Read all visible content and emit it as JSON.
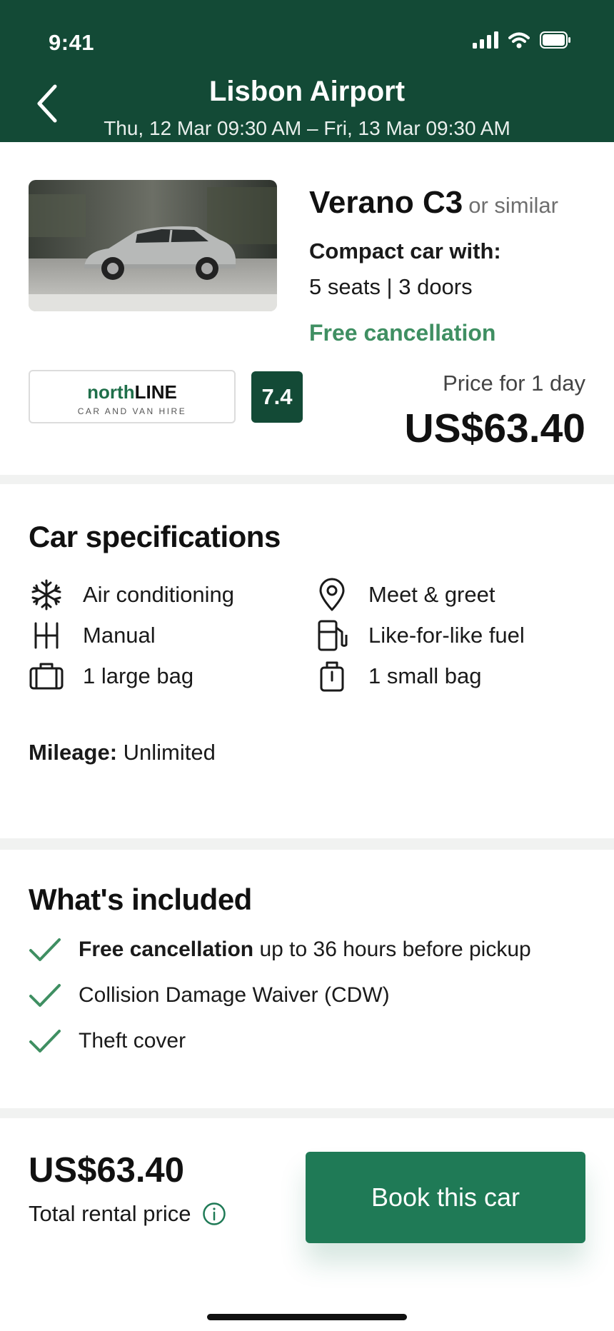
{
  "status_bar": {
    "time": "9:41"
  },
  "header": {
    "title": "Lisbon Airport",
    "dates": "Thu, 12 Mar 09:30 AM – Fri, 13 Mar 09:30 AM"
  },
  "car": {
    "name": "Verano C3",
    "similar": "or similar",
    "class": "Compact car with:",
    "seats_doors": "5 seats | 3 doors",
    "free_cancellation": "Free cancellation"
  },
  "supplier": {
    "name_first": "north",
    "name_second": "LINE",
    "tagline": "CAR AND VAN HIRE",
    "rating": "7.4"
  },
  "price": {
    "label": "Price for 1 day",
    "amount": "US$63.40"
  },
  "specs": {
    "title": "Car specifications",
    "items": [
      {
        "label": "Air conditioning",
        "icon": "snowflake-icon"
      },
      {
        "label": "Meet & greet",
        "icon": "location-pin-icon"
      },
      {
        "label": "Manual",
        "icon": "gearshift-icon"
      },
      {
        "label": "Like-for-like fuel",
        "icon": "fuel-pump-icon"
      },
      {
        "label": "1 large bag",
        "icon": "suitcase-icon"
      },
      {
        "label": "1 small bag",
        "icon": "small-bag-icon"
      }
    ],
    "mileage_label": "Mileage:",
    "mileage_value": "Unlimited"
  },
  "included": {
    "title": "What's included",
    "items": [
      {
        "bold": "Free cancellation",
        "text": "up to 36 hours before pickup"
      },
      {
        "bold": "",
        "text": "Collision Damage Waiver (CDW)"
      },
      {
        "bold": "",
        "text": "Theft cover"
      }
    ]
  },
  "footer": {
    "total": "US$63.40",
    "total_label": "Total rental price",
    "book_label": "Book this car"
  },
  "colors": {
    "header": "#134a36",
    "accent": "#1f7a56",
    "success": "#3f8f62"
  }
}
